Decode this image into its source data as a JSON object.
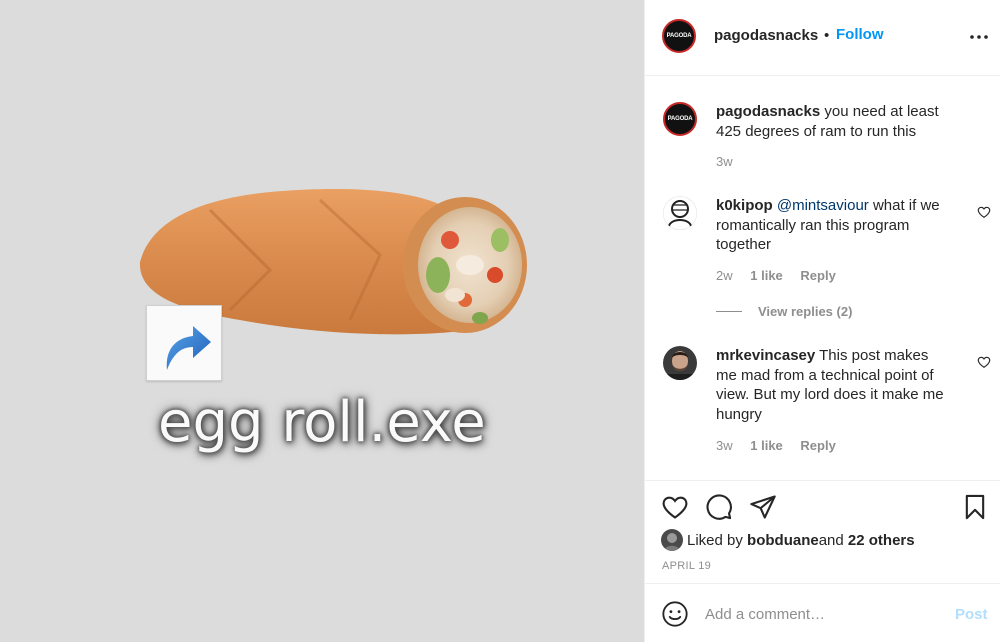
{
  "colors": {
    "accent": "#0095f6",
    "text": "#262626",
    "muted": "#8e8e8e",
    "post_disabled": "#b2dffc",
    "media_bg": "#dcdcdc"
  },
  "media": {
    "image": "egg-roll-icon",
    "shortcut_icon": "shortcut-arrow-icon",
    "filename": "egg roll.exe"
  },
  "header": {
    "avatar_text": "PAGODA",
    "username": "pagodasnacks",
    "separator": "•",
    "follow_label": "Follow",
    "more_icon": "more-options-icon"
  },
  "caption": {
    "username": "pagodasnacks",
    "text": " you need at least 425 degrees of ram to run this",
    "time": "3w"
  },
  "comments": [
    {
      "username": "k0kipop",
      "mention": "@mintsaviour",
      "text": " what if we romantically ran this program together",
      "time": "2w",
      "likes": "1 like",
      "reply": "Reply",
      "view_replies": "View replies (2)"
    },
    {
      "username": "mrkevincasey",
      "text": " This post makes me mad from a technical point of view. But my lord does it make me hungry",
      "time": "3w",
      "likes": "1 like",
      "reply": "Reply"
    }
  ],
  "actions": {
    "like_icon": "heart-icon",
    "comment_icon": "comment-icon",
    "share_icon": "share-icon",
    "save_icon": "bookmark-icon"
  },
  "likes": {
    "prefix": "Liked by ",
    "user": "bobduane",
    "middle": " and ",
    "others": "22 others"
  },
  "date": "APRIL 19",
  "add_comment": {
    "placeholder": "Add a comment…",
    "post_label": "Post",
    "emoji_icon": "emoji-icon"
  }
}
